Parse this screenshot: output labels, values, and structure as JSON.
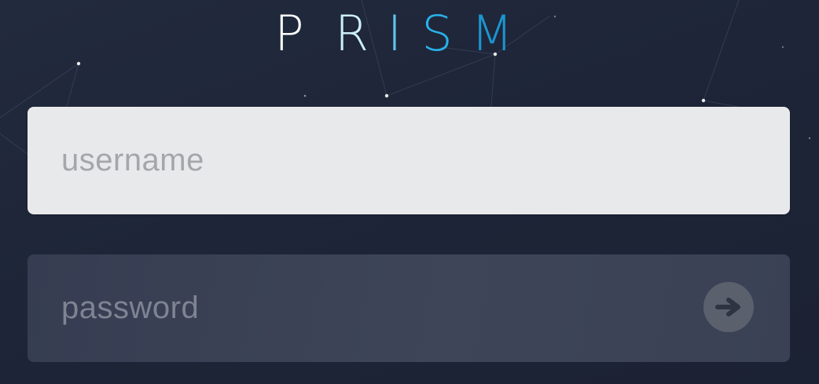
{
  "logo": {
    "letters": [
      "P",
      "R",
      "I",
      "S",
      "M"
    ],
    "colors": [
      "#ffffff",
      "#cdeefc",
      "#5fc5ee",
      "#29b2ea",
      "#1a95cf"
    ]
  },
  "login": {
    "username_placeholder": "username",
    "username_value": "",
    "password_placeholder": "password",
    "password_value": "",
    "submit_icon": "arrow-right-icon"
  },
  "colors": {
    "background": "#1f2639",
    "username_field": "#e8e9eb",
    "password_field": "#3b4255",
    "submit_button": "#5b606d",
    "submit_arrow": "#2f3443"
  }
}
